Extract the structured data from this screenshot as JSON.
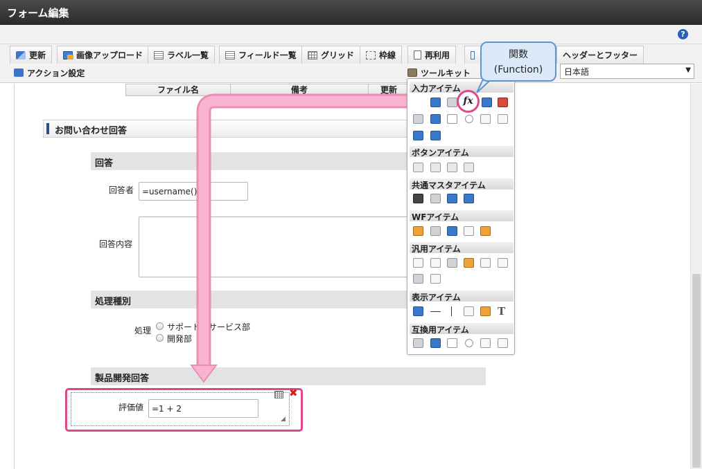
{
  "window": {
    "title": "フォーム編集"
  },
  "toolbar": {
    "update": "更新",
    "image_upload": "画像アップロード",
    "label_list": "ラベル一覧",
    "field_list": "フィールド一覧",
    "grid": "グリッド",
    "frame": "枠線",
    "reuse": "再利用",
    "header_footer": "ヘッダーとフッター",
    "action_settings": "アクション設定",
    "toolkit": "ツールキット",
    "language": "日本語"
  },
  "table_headers": [
    "ファイル名",
    "備考",
    "更新"
  ],
  "form": {
    "section_title": "お問い合わせ回答",
    "group_answer": "回答",
    "answerer_label": "回答者",
    "answerer_value": "=username()",
    "answer_content_label": "回答内容",
    "group_processing": "処理種別",
    "processing_label": "処理",
    "radio_support": "サポート・サービス部",
    "radio_dev": "開発部",
    "group_product": "製品開発回答",
    "evaluation_label": "評価値",
    "evaluation_value": "=1 + 2"
  },
  "palette": {
    "input_items": "入力アイテム",
    "button_items": "ボタンアイテム",
    "common_master_items": "共通マスタアイテム",
    "wf_items": "WFアイテム",
    "general_items": "汎用アイテム",
    "display_items": "表示アイテム",
    "compat_items": "互換用アイテム",
    "fx_symbol": "fx"
  },
  "callout": {
    "line1": "関数",
    "line2": "(Function)"
  },
  "colors": {
    "highlight": "#e0468a",
    "callout_border": "#5b94d3",
    "callout_fill": "#dbe9f8",
    "arrow": "#f5a3c6"
  }
}
